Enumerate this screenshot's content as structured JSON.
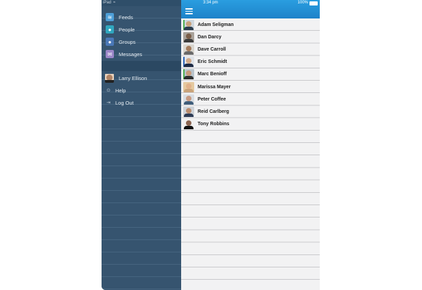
{
  "status_bar": {
    "carrier": "iPad",
    "wifi_icon": "wifi-icon",
    "time": "3:34 pm",
    "battery": "100%"
  },
  "sidebar": {
    "nav_items": [
      {
        "label": "Feeds",
        "icon": "feeds-icon",
        "color": "#4d9fd8"
      },
      {
        "label": "People",
        "icon": "people-icon",
        "color": "#30a7bf"
      },
      {
        "label": "Groups",
        "icon": "groups-icon",
        "color": "#4a78b8"
      },
      {
        "label": "Messages",
        "icon": "messages-icon",
        "color": "#9b86c8"
      }
    ],
    "user_items": [
      {
        "label": "Larry Ellison",
        "icon": "user-avatar"
      },
      {
        "label": "Help",
        "icon": "help-icon"
      },
      {
        "label": "Log Out",
        "icon": "logout-icon"
      }
    ]
  },
  "header": {
    "menu_icon": "hamburger-menu-icon",
    "accent_color": "#1f8fd6"
  },
  "people": [
    {
      "name": "Adam Seligman",
      "status_color": "#4caf50"
    },
    {
      "name": "Dan Darcy"
    },
    {
      "name": "Dave Carroll"
    },
    {
      "name": "Eric Schmidt",
      "status_color": "#2a63b8"
    },
    {
      "name": "Marc Benioff",
      "status_color": "#4caf50"
    },
    {
      "name": "Marissa Mayer"
    },
    {
      "name": "Peter Coffee"
    },
    {
      "name": "Reid Carlberg"
    },
    {
      "name": "Tony Robbins"
    }
  ]
}
